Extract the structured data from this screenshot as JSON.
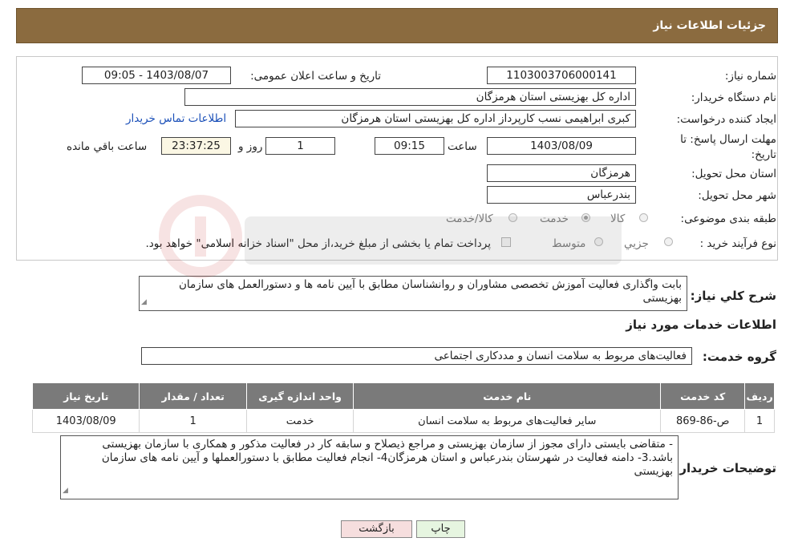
{
  "header": {
    "title": "جزئیات اطلاعات نیاز"
  },
  "form": {
    "need_number": {
      "label": "شماره نیاز:",
      "value": "1103003706000141"
    },
    "announce": {
      "label": "تاریخ و ساعت اعلان عمومی:",
      "value": "1403/08/07 - 09:05"
    },
    "buyer_org": {
      "label": "نام دستگاه خریدار:",
      "value": "اداره کل بهزیستی استان هرمزگان"
    },
    "creator": {
      "label": "ایجاد کننده درخواست:",
      "value": "کبری  ابراهیمی نسب کارپرداز اداره کل بهزیستی استان هرمزگان"
    },
    "contact_link": "اطلاعات تماس خریدار",
    "deadline": {
      "label": "مهلت ارسال پاسخ: تا تاریخ:",
      "date": "1403/08/09",
      "time_label": "ساعت",
      "time": "09:15",
      "days": "1",
      "days_label": "روز و",
      "remaining": "23:37:25",
      "remaining_label": "ساعت باقي مانده"
    },
    "province": {
      "label": "استان محل تحویل:",
      "value": "هرمزگان"
    },
    "city": {
      "label": "شهر محل تحویل:",
      "value": "بندرعباس"
    },
    "category": {
      "label": "طبقه بندی موضوعی:",
      "options": [
        "کالا",
        "خدمت",
        "کالا/خدمت"
      ],
      "selected": "خدمت"
    },
    "purchase_type": {
      "label": "نوع فرآیند خرید :",
      "options": [
        "جزیي",
        "متوسط"
      ],
      "note": "پرداخت تمام یا بخشی از مبلغ خرید،از محل \"اسناد خزانه اسلامی\" خواهد بود."
    }
  },
  "summary": {
    "label": "شرح کلي نياز:",
    "value": "بابت واگذاری فعالیت آموزش تخصصی مشاوران و روانشناسان مطابق با آیین نامه ها و دستورالعمل های سازمان بهزیستی"
  },
  "services_title": "اطلاعات خدمات مورد نياز",
  "service_group": {
    "label": "گروه خدمت:",
    "value": "فعالیت‌های مربوط به سلامت انسان و مددکاری اجتماعی"
  },
  "table": {
    "headers": [
      "رديف",
      "کد خدمت",
      "نام خدمت",
      "واحد اندازه گیری",
      "تعداد / مقدار",
      "تاریخ نیاز"
    ],
    "rows": [
      [
        "1",
        "ص-86-869",
        "سایر فعالیت‌های مربوط به سلامت انسان",
        "خدمت",
        "1",
        "1403/08/09"
      ]
    ]
  },
  "buyer_notes": {
    "label": "توضيحات خريدار:",
    "value": "- متقاضی بایستی دارای مجوز از سازمان بهزیستی و مراجع ذیصلاح و سابقه کار در فعالیت مذکور و  همکاری با سازمان بهزیستی باشد.3- دامنه فعالیت در شهرستان بندرعباس و استان هرمزگان4- انجام فعالیت مطابق با دستورالعملها و آیین نامه های سازمان بهزیستی"
  },
  "buttons": {
    "print": "چاپ",
    "back": "بازگشت"
  },
  "colors": {
    "header_bg": "#8B6B3F",
    "table_header_bg": "#7a7a7a",
    "link": "#1a4fb8",
    "back_btn_bg": "#f6dede",
    "print_btn_bg": "#e6f5e0"
  }
}
